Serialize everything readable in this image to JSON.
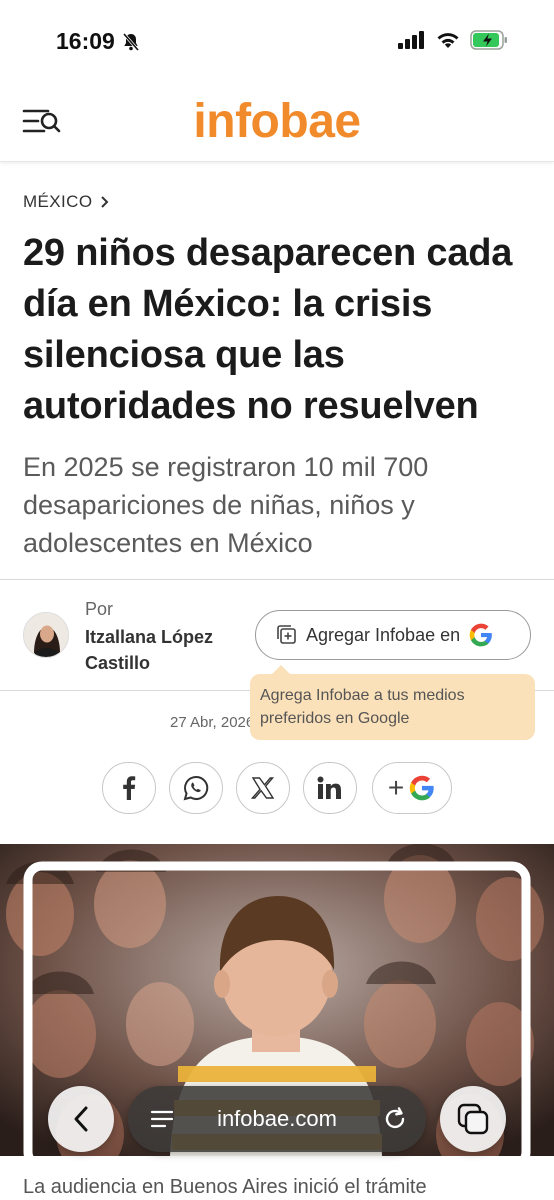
{
  "status_bar": {
    "time": "16:09",
    "icons": [
      "bell-slash-icon",
      "signal-icon",
      "wifi-icon",
      "battery-charging-icon"
    ],
    "battery_color": "#34c759"
  },
  "header": {
    "logo": "infobae",
    "logo_color": "#f18a2b",
    "menu_icon": "menu-search-icon"
  },
  "article": {
    "section": "MÉXICO",
    "headline": "29 niños desaparecen cada día en México: la crisis silenciosa que las autoridades no resuelven",
    "subhead": "En 2025 se registraron 10 mil 700 desapariciones de niñas, niños y adolescentes en México",
    "by_label": "Por",
    "author": "Itzallana López Castillo",
    "add_button_label": "Agregar Infobae en",
    "tooltip": "Agrega Infobae a tus medios preferidos en Google",
    "date": "27 Abr, 2026",
    "share_buttons": [
      "facebook-icon",
      "whatsapp-icon",
      "x-icon",
      "linkedin-icon",
      "google-add-icon"
    ],
    "share_google_plus": "+",
    "caption": "La audiencia en Buenos Aires inició el trámite"
  },
  "browser": {
    "url": "infobae.com"
  }
}
